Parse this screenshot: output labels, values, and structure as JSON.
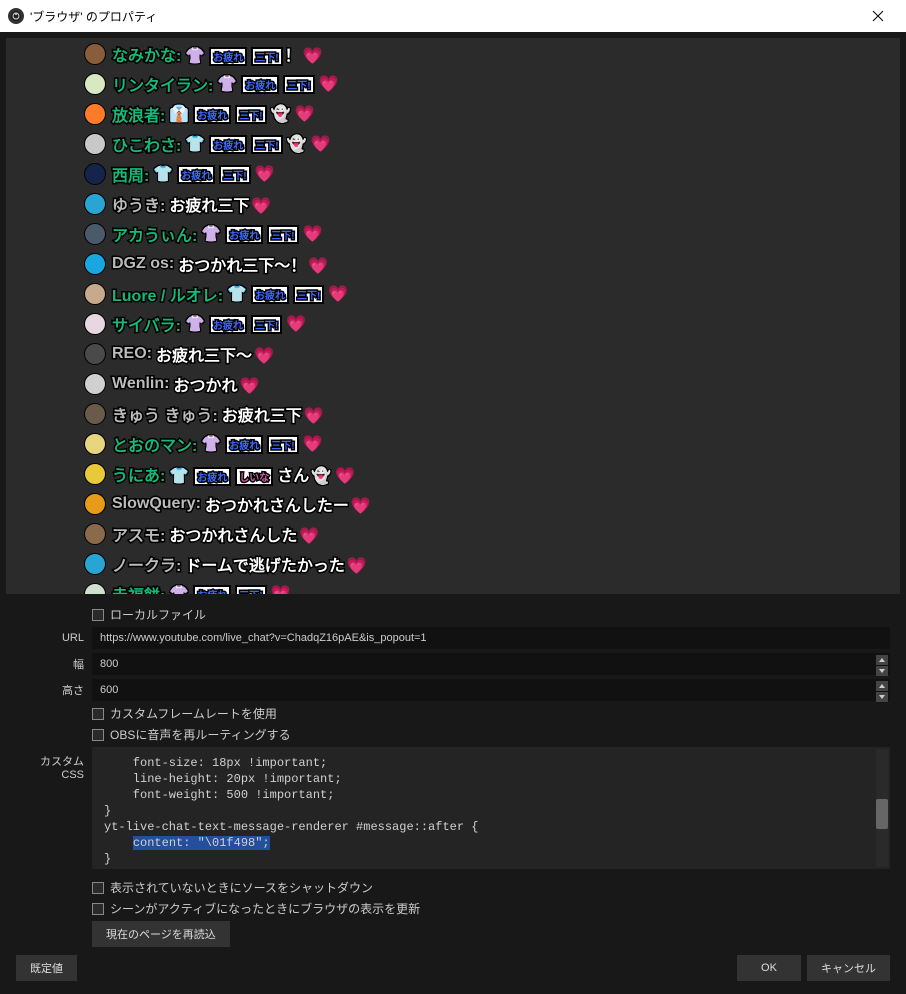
{
  "window": {
    "title": "'ブラウザ' のプロパティ"
  },
  "chat": [
    {
      "name": "なみかな",
      "type": "member",
      "avatar": "#8a5d3a",
      "msgType": "stampHeart"
    },
    {
      "name": "リンタイラン",
      "type": "member",
      "avatar": "#d8e8c0",
      "msgType": "shirtStampHeart"
    },
    {
      "name": "放浪者",
      "type": "member",
      "avatar": "#ff7a29",
      "msgType": "whiteShirtGhostHeart"
    },
    {
      "name": "ひこわさ",
      "type": "member",
      "avatar": "#c8c8c8",
      "msgType": "greenShirtGhostHeart"
    },
    {
      "name": "西周",
      "type": "member",
      "avatar": "#14244a",
      "msgType": "greenShirtStampHeart"
    },
    {
      "name": "ゆうき",
      "type": "normal",
      "avatar": "#29a5d4",
      "msgType": "plainHeart",
      "text": "お疲れ三下"
    },
    {
      "name": "アカうぃん",
      "type": "member",
      "avatar": "#4a5a6a",
      "msgType": "shirtStampHeart"
    },
    {
      "name": "DGZ os",
      "type": "normal",
      "avatar": "#1aa6e0",
      "msgType": "plainHeart",
      "text": "おつかれ三下〜！"
    },
    {
      "name": "Luore / ルオレ",
      "type": "member",
      "avatar": "#c7a98c",
      "msgType": "greenShirtStampHeart"
    },
    {
      "name": "サイバラ",
      "type": "member",
      "avatar": "#e8d6e2",
      "msgType": "pinkShirtStampHeart"
    },
    {
      "name": "REO",
      "type": "normal",
      "avatar": "#4a4a4a",
      "msgType": "plainHeart",
      "text": "お疲れ三下〜"
    },
    {
      "name": "Wenlin",
      "type": "normal",
      "avatar": "#d0d0d0",
      "msgType": "plainHeart",
      "text": "おつかれ"
    },
    {
      "name": "きゅう きゅう",
      "type": "normal",
      "avatar": "#6a5a4a",
      "msgType": "plainHeart",
      "text": "お疲れ三下"
    },
    {
      "name": "とおのマン",
      "type": "member",
      "avatar": "#e8d67e",
      "msgType": "shirtStampHeart"
    },
    {
      "name": "うにあ",
      "type": "member",
      "avatar": "#e8c93a",
      "msgType": "uniaSpecial",
      "text": "さん"
    },
    {
      "name": "SlowQuery",
      "type": "normal",
      "avatar": "#e89a1a",
      "msgType": "plainHeart",
      "text": "おつかれさんしたー"
    },
    {
      "name": "アスモ",
      "type": "normal",
      "avatar": "#8a6a4a",
      "msgType": "plainHeart",
      "text": "おつかれさんした"
    },
    {
      "name": "ノークラ",
      "type": "normal",
      "avatar": "#29a5d4",
      "msgType": "plainHeart",
      "text": "ドームで逃げたかった"
    },
    {
      "name": "赤福餅",
      "type": "member",
      "avatar": "#d0e0d0",
      "msgType": "pinkShirtStampHeart"
    }
  ],
  "form": {
    "localFileLabel": "ローカルファイル",
    "urlLabel": "URL",
    "urlValue": "https://www.youtube.com/live_chat?v=ChadqZ16pAE&is_popout=1",
    "widthLabel": "幅",
    "widthValue": "800",
    "heightLabel": "高さ",
    "heightValue": "600",
    "customFpsLabel": "カスタムフレームレートを使用",
    "rerouteAudioLabel": "OBSに音声を再ルーティングする",
    "customCssLabel": "カスタム CSS",
    "cssLines": [
      "    font-size: 18px !important;",
      "    line-height: 20px !important;",
      "    font-weight: 500 !important;",
      "}",
      "yt-live-chat-text-message-renderer #message::after {"
    ],
    "cssSelected": "content: \"\\01f498\";",
    "cssAfter": "}",
    "shutdownLabel": "表示されていないときにソースをシャットダウン",
    "refreshLabel": "シーンがアクティブになったときにブラウザの表示を更新",
    "reloadBtn": "現在のページを再読込"
  },
  "footer": {
    "defaults": "既定値",
    "ok": "OK",
    "cancel": "キャンセル"
  }
}
